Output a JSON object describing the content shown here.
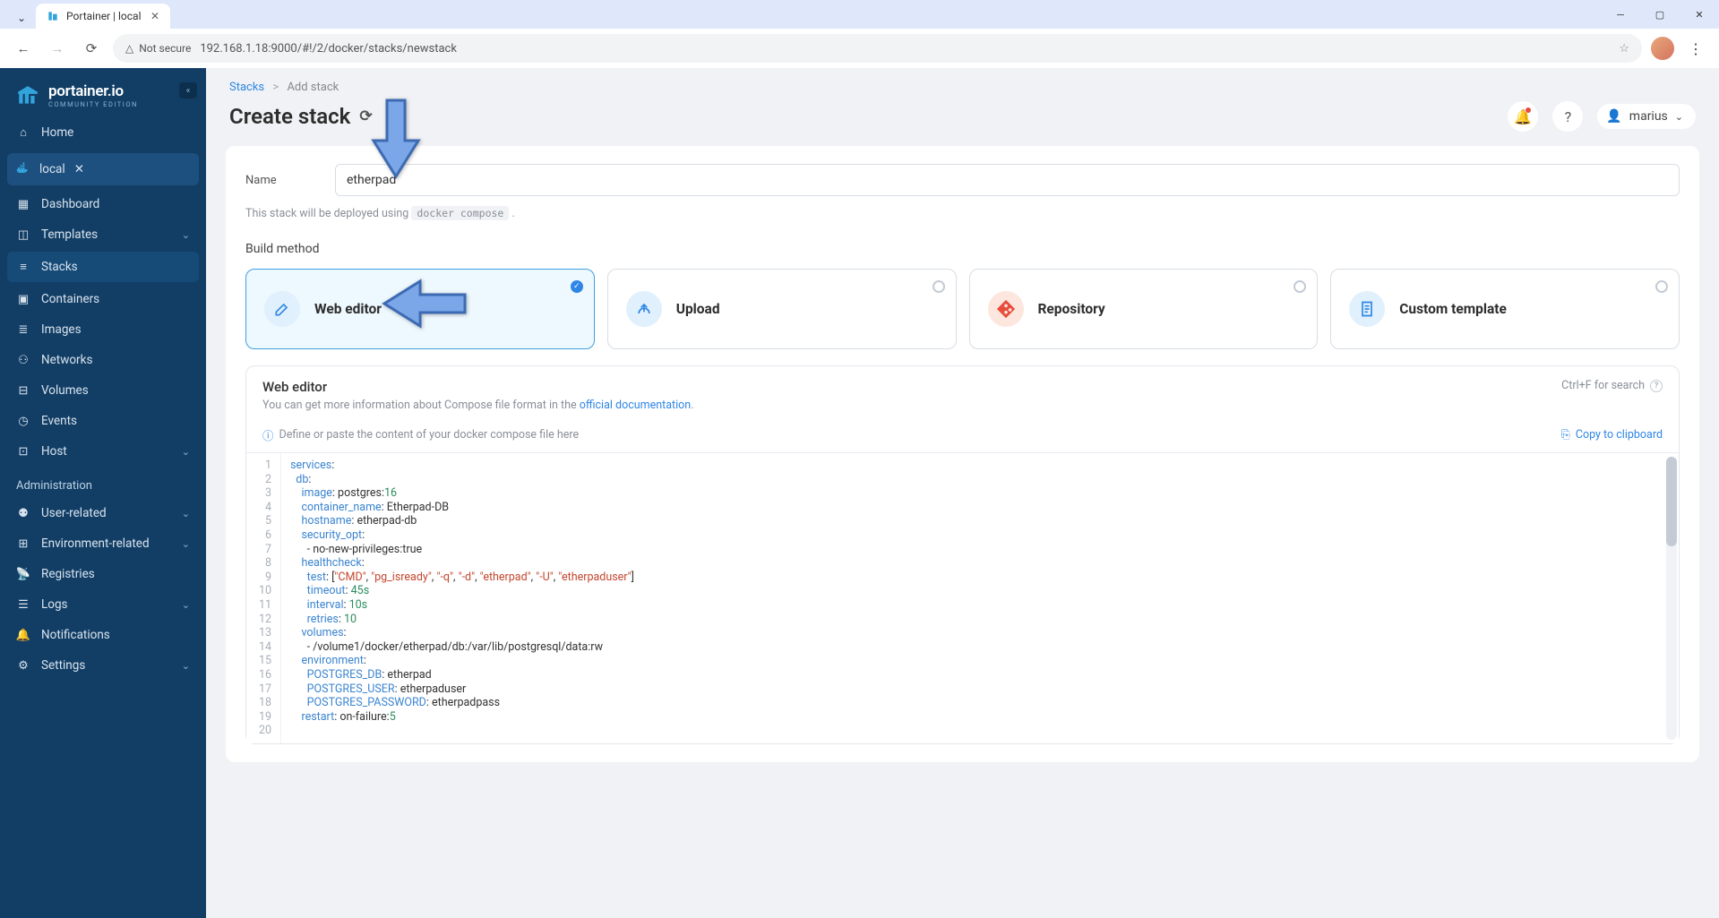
{
  "browser": {
    "tab_title": "Portainer | local",
    "url": "192.168.1.18:9000/#!/2/docker/stacks/newstack",
    "security_label": "Not secure"
  },
  "sidebar": {
    "logo_main": "portainer.io",
    "logo_sub": "COMMUNITY EDITION",
    "home": "Home",
    "env_name": "local",
    "items": {
      "dashboard": "Dashboard",
      "templates": "Templates",
      "stacks": "Stacks",
      "containers": "Containers",
      "images": "Images",
      "networks": "Networks",
      "volumes": "Volumes",
      "events": "Events",
      "host": "Host"
    },
    "admin_title": "Administration",
    "admin_items": {
      "user_related": "User-related",
      "env_related": "Environment-related",
      "registries": "Registries",
      "logs": "Logs",
      "notifications": "Notifications",
      "settings": "Settings"
    }
  },
  "breadcrumb": {
    "root": "Stacks",
    "current": "Add stack"
  },
  "page": {
    "title": "Create stack",
    "user": "marius"
  },
  "form": {
    "name_label": "Name",
    "name_value": "etherpad",
    "deploy_hint_prefix": "This stack will be deployed using ",
    "deploy_hint_code": "docker compose",
    "build_method_label": "Build method"
  },
  "methods": {
    "web_editor": "Web editor",
    "upload": "Upload",
    "repository": "Repository",
    "custom_template": "Custom template"
  },
  "editor": {
    "title": "Web editor",
    "subtitle_prefix": "You can get more information about Compose file format in the ",
    "subtitle_link": "official documentation",
    "search_hint": "Ctrl+F for search",
    "placeholder_hint": "Define or paste the content of your docker compose file here",
    "copy_label": "Copy to clipboard",
    "code_lines": [
      "services:",
      "  db:",
      "    image: postgres:16",
      "    container_name: Etherpad-DB",
      "    hostname: etherpad-db",
      "    security_opt:",
      "      - no-new-privileges:true",
      "    healthcheck:",
      "      test: [\"CMD\", \"pg_isready\", \"-q\", \"-d\", \"etherpad\", \"-U\", \"etherpaduser\"]",
      "      timeout: 45s",
      "      interval: 10s",
      "      retries: 10",
      "    volumes:",
      "      - /volume1/docker/etherpad/db:/var/lib/postgresql/data:rw",
      "    environment:",
      "      POSTGRES_DB: etherpad",
      "      POSTGRES_USER: etherpaduser",
      "      POSTGRES_PASSWORD: etherpadpass",
      "    restart: on-failure:5",
      ""
    ]
  }
}
